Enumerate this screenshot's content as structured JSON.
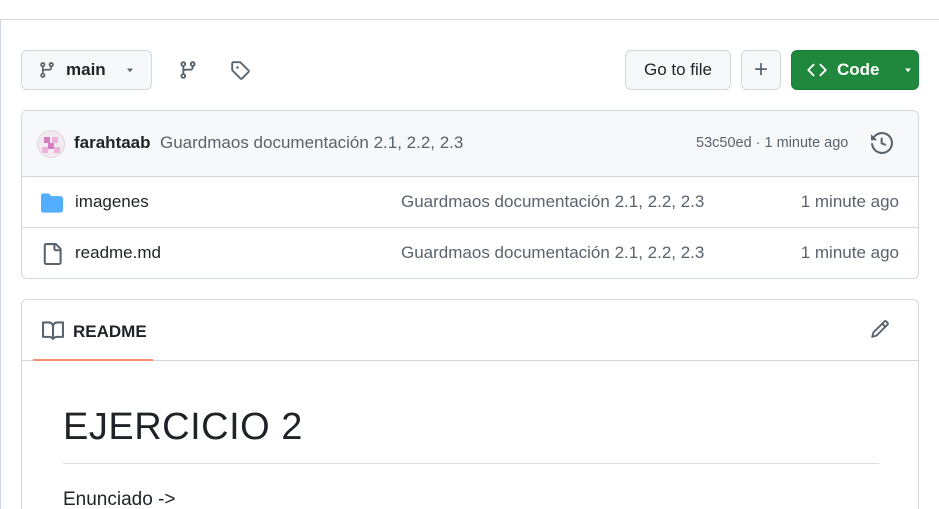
{
  "toolbar": {
    "branch_label": "main",
    "goto_label": "Go to file",
    "add_label": "+",
    "code_label": "Code"
  },
  "commit": {
    "author": "farahtaab",
    "message": "Guardmaos documentación 2.1, 2.2, 2.3",
    "meta": "53c50ed · 1 minute ago"
  },
  "files": [
    {
      "name": "imagenes",
      "type": "folder",
      "message": "Guardmaos documentación 2.1, 2.2, 2.3",
      "age": "1 minute ago"
    },
    {
      "name": "readme.md",
      "type": "file",
      "message": "Guardmaos documentación 2.1, 2.2, 2.3",
      "age": "1 minute ago"
    }
  ],
  "readme": {
    "tab_label": "README",
    "heading": "EJERCICIO 2",
    "paragraph": "Enunciado ->"
  },
  "colors": {
    "accent_green": "#1f883d",
    "folder_blue": "#54aeff",
    "tab_underline": "#fd8c73",
    "muted_text": "#59636e"
  },
  "icons": [
    "git-branch-icon",
    "branches-icon",
    "tag-icon",
    "history-icon",
    "folder-icon",
    "file-icon",
    "book-icon",
    "pencil-icon",
    "code-icon",
    "chevron-down-icon"
  ]
}
